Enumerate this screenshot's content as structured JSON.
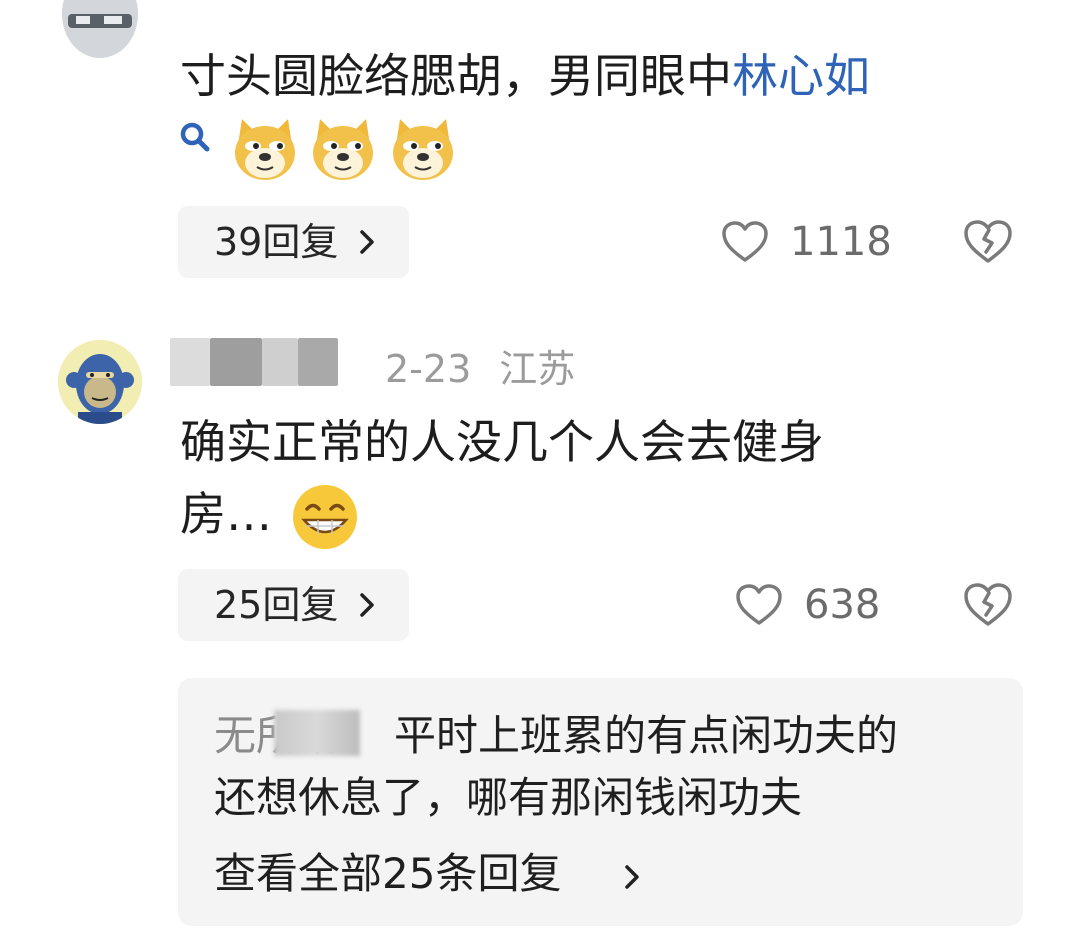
{
  "comments": [
    {
      "text_main": "寸头圆脸络腮胡，男同眼中",
      "text_link": "林心如",
      "replies_label": "39回复",
      "likes": "1118"
    },
    {
      "date": "2-23",
      "location": "江苏",
      "text_line1": "确实正常的人没几个人会去健身",
      "text_line2": "房…",
      "replies_label": "25回复",
      "likes": "638",
      "top_reply": {
        "author_fragment": "无所谓",
        "text_line1": "平时上班累的有点闲功夫的",
        "text_line2": "还想休息了，哪有那闲钱闲功夫",
        "view_all": "查看全部25条回复"
      }
    }
  ],
  "colors": {
    "link": "#2f63b8",
    "pill_bg": "#f4f4f4",
    "meta_text": "#9b9b9b"
  },
  "icons": [
    "search-icon",
    "doge-emoji",
    "grin-emoji",
    "heart-icon",
    "broken-heart-icon",
    "chevron-right-icon"
  ]
}
